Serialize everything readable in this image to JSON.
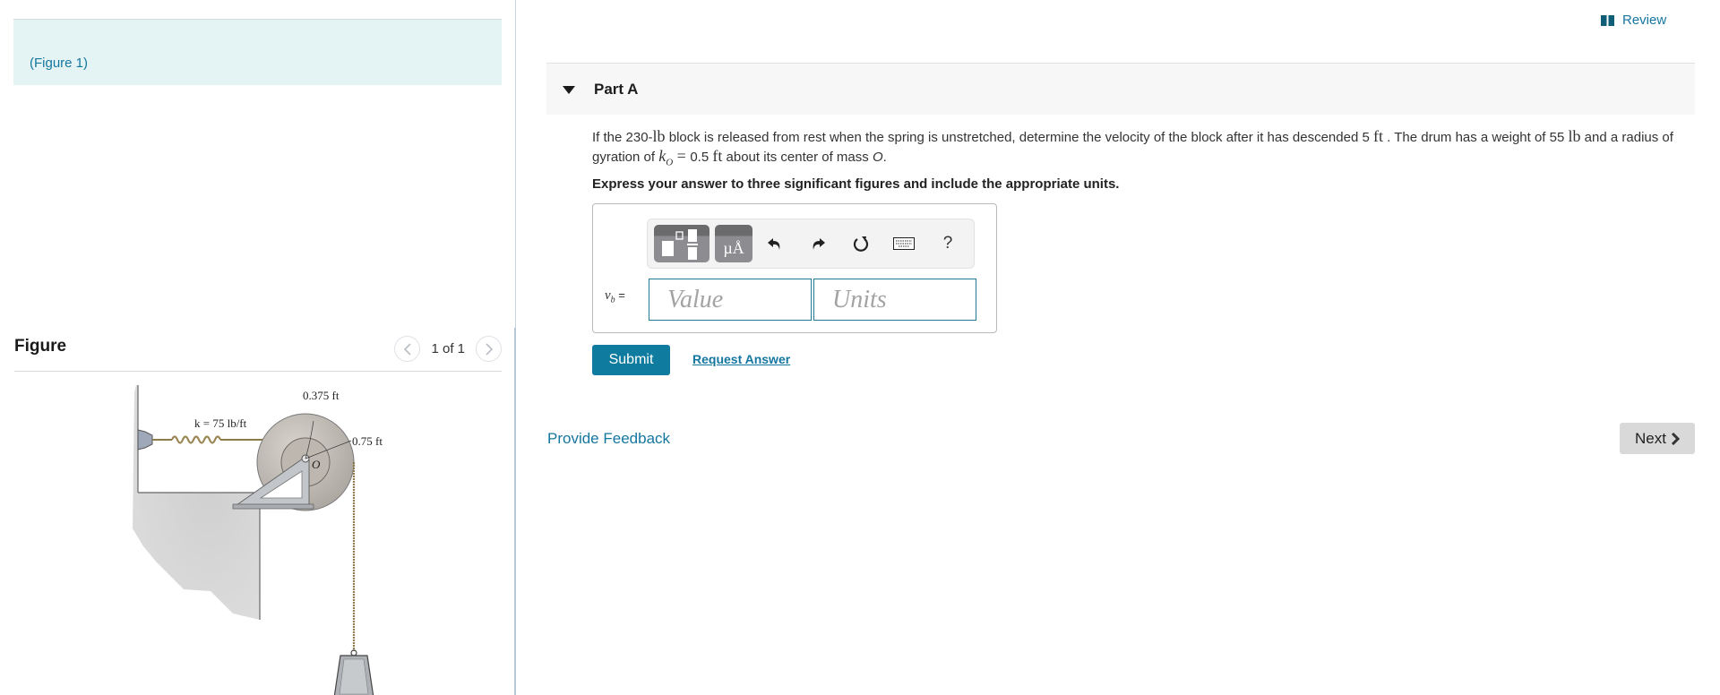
{
  "left_pane": {
    "figure_link": "(Figure 1)",
    "figure_title": "Figure",
    "pager": {
      "current": "1 of 1",
      "prev_icon": "chevron-left-icon",
      "next_icon": "chevron-right-icon"
    },
    "figure": {
      "spring_label": "k = 75 lb/ft",
      "inner_radius_label": "0.375 ft",
      "outer_radius_label": "0.75 ft",
      "center_label": "O"
    }
  },
  "header": {
    "review_label": "Review",
    "review_icon": "book-icon"
  },
  "part": {
    "title": "Part A",
    "toggle_icon": "caret-down-icon",
    "question": {
      "t1": "If the 230-",
      "m1": "lb",
      "t2": " block is released from rest when the spring is unstretched, determine the velocity of the block after it has descended 5 ",
      "m2": "ft",
      "t3": " . The drum has a weight of 55 ",
      "m3": "lb",
      "t4": " and a radius of gyration of ",
      "m4_var": "k",
      "m4_sub": "O",
      "m4_eq": " = ",
      "t5": "0.5 ",
      "m5": "ft",
      "t6": " about its center of mass ",
      "t7": "O",
      "t8": "."
    },
    "instruction": "Express your answer to three significant figures and include the appropriate units.",
    "toolbar": {
      "template_icon": "templates-icon",
      "units_label": "µÅ",
      "undo_icon": "undo-icon",
      "redo_icon": "redo-icon",
      "reset_icon": "reset-icon",
      "keyboard_icon": "keyboard-icon",
      "help_label": "?"
    },
    "answer": {
      "var": "v",
      "var_sub": "b",
      "equals": "=",
      "value_placeholder": "Value",
      "value": "",
      "units_placeholder": "Units",
      "units": ""
    },
    "submit_label": "Submit",
    "request_answer_label": "Request Answer"
  },
  "footer": {
    "feedback_label": "Provide Feedback",
    "next_label": "Next"
  }
}
